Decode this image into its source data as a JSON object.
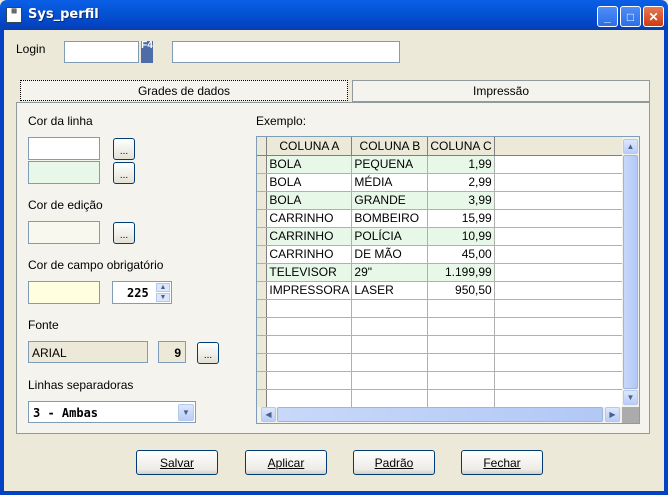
{
  "window": {
    "title": "Sys_perfil",
    "controls": [
      "_",
      "□",
      "✕"
    ]
  },
  "login": {
    "label": "Login",
    "code": "",
    "f4": "F4",
    "name": ""
  },
  "tabs": [
    {
      "label": "Grades de dados"
    },
    {
      "label": "Impressão"
    }
  ],
  "colors": {
    "accent": "#0454D6",
    "row_even": "#E8F8E8",
    "row_odd": "#FFFFFF",
    "required": "#FFFFE0",
    "edit": "#F8F8EE"
  },
  "left": {
    "cor_linha": "Cor da linha",
    "cor_edicao": "Cor de edição",
    "cor_obrigatorio": "Cor de campo obrigatório",
    "obrigatorio_value": "225",
    "fonte": "Fonte",
    "fonte_name": "ARIAL",
    "fonte_size": "9",
    "linhas": "Linhas separadoras",
    "linhas_value": "3 - Ambas",
    "ellipsis": "..."
  },
  "grid": {
    "label": "Exemplo:",
    "columns": [
      "COLUNA A",
      "COLUNA B",
      "COLUNA C"
    ],
    "rows": [
      [
        "BOLA",
        "PEQUENA",
        "1,99"
      ],
      [
        "BOLA",
        "MÉDIA",
        "2,99"
      ],
      [
        "BOLA",
        "GRANDE",
        "3,99"
      ],
      [
        "CARRINHO",
        "BOMBEIRO",
        "15,99"
      ],
      [
        "CARRINHO",
        "POLÍCIA",
        "10,99"
      ],
      [
        "CARRINHO",
        "DE MÃO",
        "45,00"
      ],
      [
        "TELEVISOR",
        "29\"",
        "1.199,99"
      ],
      [
        "IMPRESSORA",
        "LASER",
        "950,50"
      ]
    ]
  },
  "buttons": {
    "salvar": "Salvar",
    "aplicar": "Aplicar",
    "padrao": "Padrão",
    "fechar": "Fechar"
  }
}
